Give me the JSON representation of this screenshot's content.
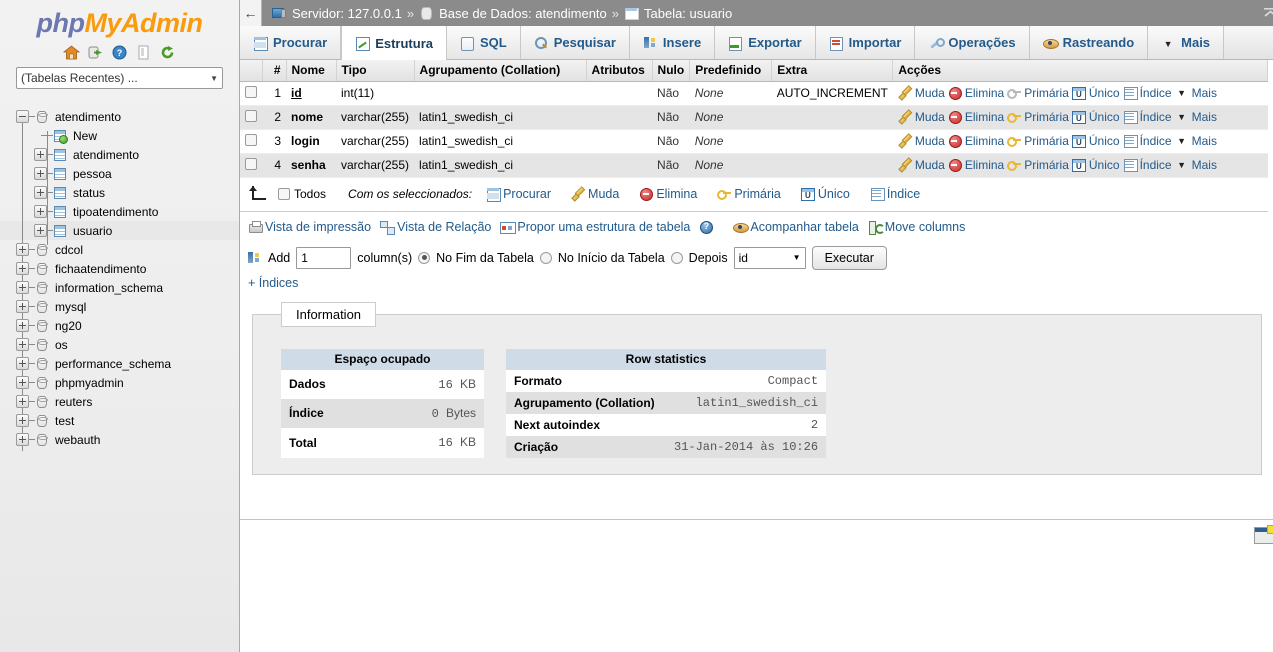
{
  "sidebar": {
    "logo": {
      "php": "php",
      "my": "My",
      "admin": "Admin"
    },
    "icons": [
      {
        "name": "home-icon",
        "label": "Home"
      },
      {
        "name": "logout-icon",
        "label": "Log out"
      },
      {
        "name": "help-icon",
        "label": "Help"
      },
      {
        "name": "docs-icon",
        "label": "Documentation"
      },
      {
        "name": "reload-icon",
        "label": "Reload"
      }
    ],
    "recent_select": {
      "value": "(Tabelas Recentes) ...",
      "caret": "▼"
    },
    "tree": [
      {
        "label": "atendimento",
        "type": "db",
        "expanded": true,
        "depth": 0
      },
      {
        "label": "New",
        "type": "new-table",
        "depth": 1
      },
      {
        "label": "atendimento",
        "type": "table",
        "depth": 1
      },
      {
        "label": "pessoa",
        "type": "table",
        "depth": 1
      },
      {
        "label": "status",
        "type": "table",
        "depth": 1
      },
      {
        "label": "tipoatendimento",
        "type": "table",
        "depth": 1
      },
      {
        "label": "usuario",
        "type": "table",
        "depth": 1,
        "selected": true
      },
      {
        "label": "cdcol",
        "type": "db",
        "depth": 0
      },
      {
        "label": "fichaatendimento",
        "type": "db",
        "depth": 0
      },
      {
        "label": "information_schema",
        "type": "db",
        "depth": 0
      },
      {
        "label": "mysql",
        "type": "db",
        "depth": 0
      },
      {
        "label": "ng20",
        "type": "db",
        "depth": 0
      },
      {
        "label": "os",
        "type": "db",
        "depth": 0
      },
      {
        "label": "performance_schema",
        "type": "db",
        "depth": 0
      },
      {
        "label": "phpmyadmin",
        "type": "db",
        "depth": 0
      },
      {
        "label": "reuters",
        "type": "db",
        "depth": 0
      },
      {
        "label": "test",
        "type": "db",
        "depth": 0
      },
      {
        "label": "webauth",
        "type": "db",
        "depth": 0
      }
    ]
  },
  "topbar": {
    "back_label": "←",
    "server_label": "Servidor: 127.0.0.1",
    "database_label": "Base de Dados: atendimento",
    "table_label": "Tabela: usuario",
    "separator": "»",
    "collapse_label": "⤒"
  },
  "tabs": [
    {
      "label": "Procurar",
      "icon": "browse-icon",
      "active": false
    },
    {
      "label": "Estrutura",
      "icon": "structure-icon",
      "active": true
    },
    {
      "label": "SQL",
      "icon": "sql-icon",
      "active": false
    },
    {
      "label": "Pesquisar",
      "icon": "search-icon",
      "active": false
    },
    {
      "label": "Insere",
      "icon": "insert-icon",
      "active": false
    },
    {
      "label": "Exportar",
      "icon": "export-icon",
      "active": false
    },
    {
      "label": "Importar",
      "icon": "import-icon",
      "active": false
    },
    {
      "label": "Operações",
      "icon": "operations-icon",
      "active": false
    },
    {
      "label": "Rastreando",
      "icon": "tracking-icon",
      "active": false
    },
    {
      "label": "Mais",
      "icon": "chevron-down-icon",
      "active": false
    }
  ],
  "structure": {
    "headers": [
      "",
      "#",
      "Nome",
      "Tipo",
      "Agrupamento (Collation)",
      "Atributos",
      "Nulo",
      "Predefinido",
      "Extra",
      "Acções"
    ],
    "rows": [
      {
        "num": "1",
        "name": "id",
        "primary": true,
        "type": "int(11)",
        "collation": "",
        "attributes": "",
        "null": "Não",
        "default": "None",
        "extra": "AUTO_INCREMENT",
        "key_grey": true
      },
      {
        "num": "2",
        "name": "nome",
        "primary": false,
        "type": "varchar(255)",
        "collation": "latin1_swedish_ci",
        "attributes": "",
        "null": "Não",
        "default": "None",
        "extra": "",
        "key_grey": false
      },
      {
        "num": "3",
        "name": "login",
        "primary": false,
        "type": "varchar(255)",
        "collation": "latin1_swedish_ci",
        "attributes": "",
        "null": "Não",
        "default": "None",
        "extra": "",
        "key_grey": false
      },
      {
        "num": "4",
        "name": "senha",
        "primary": false,
        "type": "varchar(255)",
        "collation": "latin1_swedish_ci",
        "attributes": "",
        "null": "Não",
        "default": "None",
        "extra": "",
        "key_grey": false
      }
    ],
    "row_actions": [
      {
        "label": "Muda",
        "icon": "pencil-icon"
      },
      {
        "label": "Elimina",
        "icon": "delete-icon"
      },
      {
        "label": "Primária",
        "icon": "key-icon"
      },
      {
        "label": "Único",
        "icon": "unique-icon"
      },
      {
        "label": "Índice",
        "icon": "index-icon"
      },
      {
        "label": "Mais",
        "icon": "chevron-down-icon"
      }
    ]
  },
  "with_selected": {
    "check_all_label": "Todos",
    "prefix": "Com os seleccionados:",
    "actions": [
      {
        "label": "Procurar",
        "icon": "browse-icon"
      },
      {
        "label": "Muda",
        "icon": "pencil-icon"
      },
      {
        "label": "Elimina",
        "icon": "delete-icon"
      },
      {
        "label": "Primária",
        "icon": "key-icon"
      },
      {
        "label": "Único",
        "icon": "unique-icon"
      },
      {
        "label": "Índice",
        "icon": "index-icon"
      }
    ]
  },
  "view_links": [
    {
      "label": "Vista de impressão",
      "icon": "print-icon"
    },
    {
      "label": "Vista de Relação",
      "icon": "relation-icon"
    },
    {
      "label": "Propor uma estrutura de tabela",
      "icon": "propose-icon"
    },
    {
      "label": "",
      "icon": "help-icon"
    },
    {
      "label": "Acompanhar tabela",
      "icon": "eye-icon"
    },
    {
      "label": "Move columns",
      "icon": "move-columns-icon"
    }
  ],
  "add_form": {
    "add_label": "Add",
    "count_value": "1",
    "count_placeholder": "",
    "columns_label": "column(s)",
    "opt_end": "No Fim da Tabela",
    "opt_start": "No Início da Tabela",
    "opt_after": "Depois",
    "selected_option": "end",
    "after_column_value": "id",
    "after_caret": "▼",
    "execute_label": "Executar",
    "indices_link": "+ Índices"
  },
  "info_panel": {
    "legend": "Information",
    "space_table": {
      "title": "Espaço ocupado",
      "rows": [
        {
          "key": "Dados",
          "num": "16",
          "unit": "KB"
        },
        {
          "key": "Índice",
          "num": "0",
          "unit": "Bytes"
        },
        {
          "key": "Total",
          "num": "16",
          "unit": "KB"
        }
      ]
    },
    "row_stats_table": {
      "title": "Row statistics",
      "rows": [
        {
          "key": "Formato",
          "value": "Compact"
        },
        {
          "key": "Agrupamento (Collation)",
          "value": "latin1_swedish_ci"
        },
        {
          "key": "Next autoindex",
          "value": "2"
        },
        {
          "key": "Criação",
          "value": "31-Jan-2014 às 10:26"
        }
      ]
    }
  },
  "footer": {
    "console_icon": "console-icon"
  },
  "colors": {
    "topbar_bg": "#8b8b8b",
    "link": "#235a8a",
    "row_even": "#e5e5e5",
    "stat_header": "#cfdce8",
    "fieldset_bg": "#ededed",
    "logo_orange": "#f89c0e",
    "logo_blue": "#6c78af"
  }
}
